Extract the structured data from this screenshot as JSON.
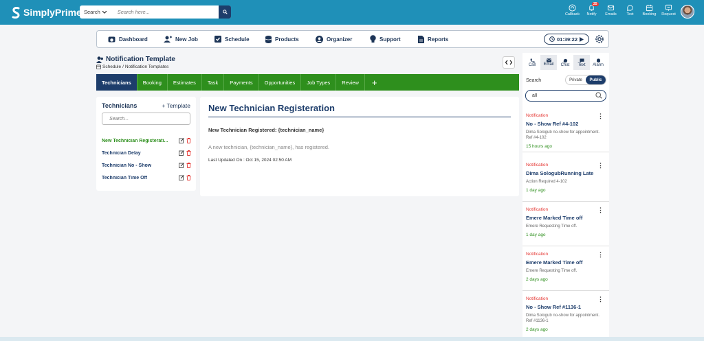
{
  "app": {
    "name": "SimplyPrime"
  },
  "search": {
    "scope_label": "Search",
    "placeholder": "Search here..."
  },
  "top_actions": [
    {
      "label": "Callback",
      "icon": "headset-icon"
    },
    {
      "label": "Notify",
      "icon": "bell-icon",
      "badge": "25"
    },
    {
      "label": "Emails",
      "icon": "mail-icon"
    },
    {
      "label": "Text",
      "icon": "chat-icon"
    },
    {
      "label": "Booking",
      "icon": "calendar-icon"
    },
    {
      "label": "Request",
      "icon": "request-icon"
    }
  ],
  "nav": {
    "dashboard": "Dashboard",
    "new_job": "New Job",
    "schedule": "Schedule",
    "products": "Products",
    "organizer": "Organizer",
    "support": "Support",
    "reports": "Reports",
    "timer": "01:39:22"
  },
  "page": {
    "title": "Notification Template",
    "breadcrumb_root": "Schedule",
    "breadcrumb_sep": "/",
    "breadcrumb_current": "Notification Templates"
  },
  "tabs": [
    "Technicians",
    "Booking",
    "Estimates",
    "Task",
    "Payments",
    "Opportunities",
    "Job Types",
    "Review",
    "+"
  ],
  "left_panel": {
    "title": "Technicians",
    "add_label": "+ Template",
    "search_placeholder": "Search...",
    "items": [
      "New Technician Registerati...",
      "Technician Delay",
      "Technician No - Show",
      "Technician Time Off"
    ]
  },
  "template": {
    "title": "New Technician Registeration",
    "subject": "New Technician Registered: {technician_name}",
    "body": "A new technician, {technician_name}, has registered.",
    "updated": "Last Updated On : Oct 15, 2024 02:50 AM"
  },
  "right_panel": {
    "tabs": [
      "Call",
      "Email",
      "Chat",
      "Text",
      "Alarm"
    ],
    "search_label": "Search",
    "toggle_private": "Private",
    "toggle_public": "Public",
    "search_value": "all",
    "notifications": [
      {
        "type": "Notification",
        "title": "No - Show Ref #4-102",
        "desc": "Dima Sologub no-show for appointment. Ref #4-102",
        "time": "15 hours ago"
      },
      {
        "type": "Notification",
        "title": "Dima SologubRunning Late",
        "desc": "Action Required 4-102",
        "time": "1 day ago"
      },
      {
        "type": "Notification",
        "title": "Emere Marked Time off",
        "desc": "Emere Requesting Time off.",
        "time": "1 day ago"
      },
      {
        "type": "Notification",
        "title": "Emere Marked Time off",
        "desc": "Emere Requesting Time off.",
        "time": "2 days ago"
      },
      {
        "type": "Notification",
        "title": "No - Show Ref #1136-1",
        "desc": "Dima Sologub no-show for appointment. Ref #1136-1",
        "time": "2 days ago"
      }
    ]
  },
  "colors": {
    "topbar": "#1f90b8",
    "navy": "#1d3d6b",
    "green": "#2e8f1d",
    "red": "#e53935"
  }
}
